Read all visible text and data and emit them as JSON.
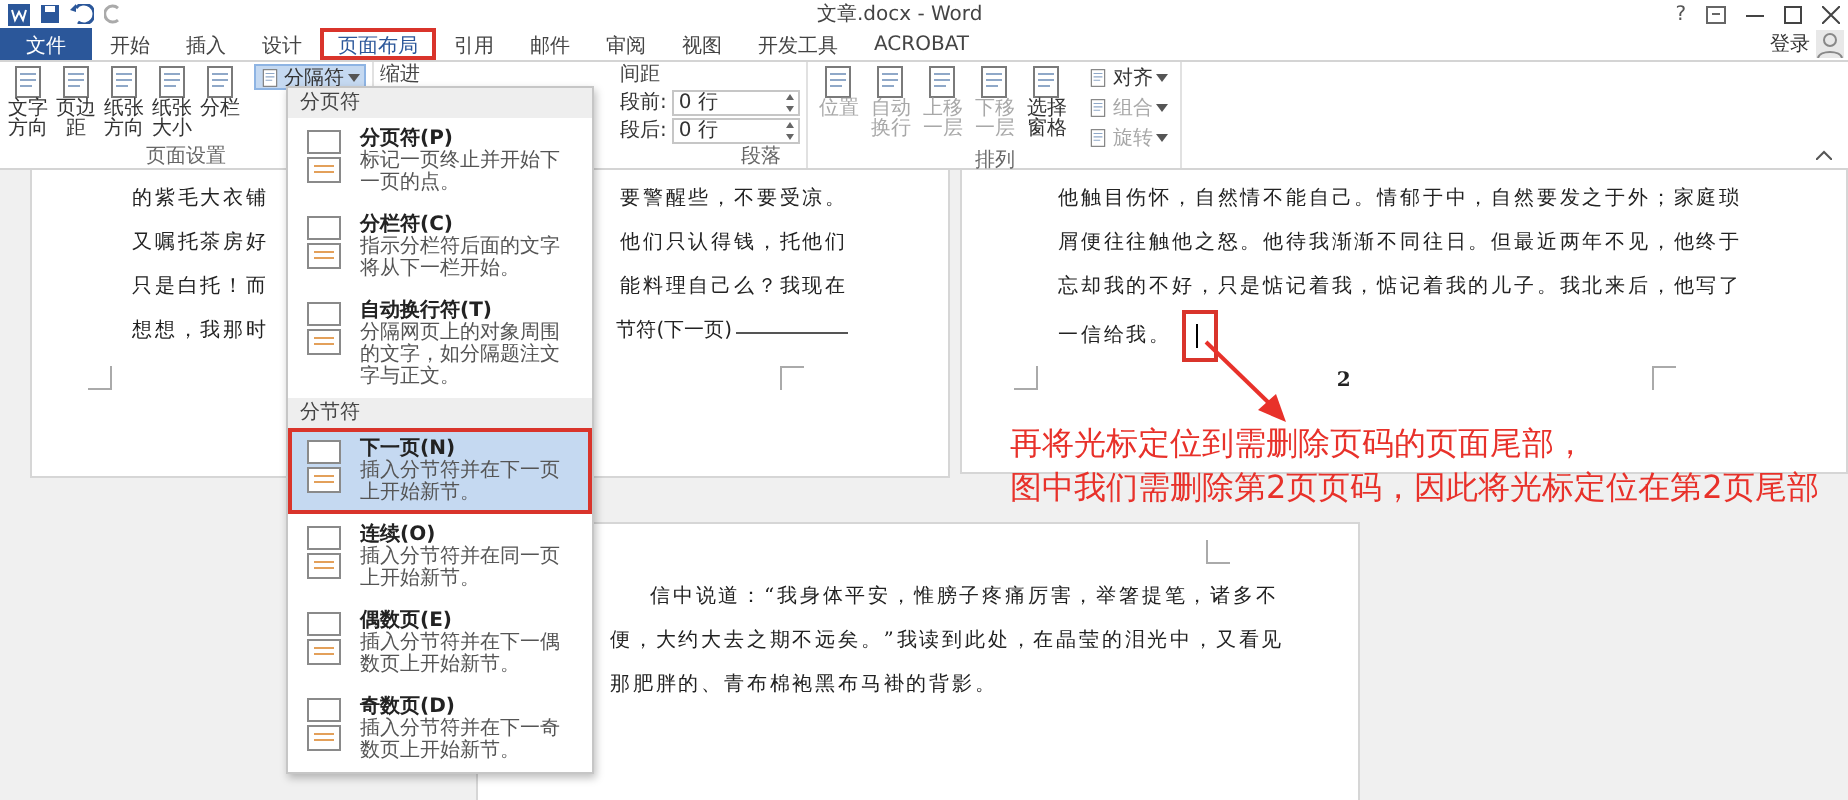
{
  "title_bar": {
    "title": "文章.docx - Word",
    "help": "?"
  },
  "tabs": [
    {
      "label": "文件",
      "kind": "file",
      "selected": false,
      "highlighted": false
    },
    {
      "label": "开始",
      "kind": "tab",
      "selected": false,
      "highlighted": false
    },
    {
      "label": "插入",
      "kind": "tab",
      "selected": false,
      "highlighted": false
    },
    {
      "label": "设计",
      "kind": "tab",
      "selected": false,
      "highlighted": false
    },
    {
      "label": "页面布局",
      "kind": "tab",
      "selected": true,
      "highlighted": true
    },
    {
      "label": "引用",
      "kind": "tab",
      "selected": false,
      "highlighted": false
    },
    {
      "label": "邮件",
      "kind": "tab",
      "selected": false,
      "highlighted": false
    },
    {
      "label": "审阅",
      "kind": "tab",
      "selected": false,
      "highlighted": false
    },
    {
      "label": "视图",
      "kind": "tab",
      "selected": false,
      "highlighted": false
    },
    {
      "label": "开发工具",
      "kind": "tab",
      "selected": false,
      "highlighted": false
    },
    {
      "label": "ACROBAT",
      "kind": "tab",
      "selected": false,
      "highlighted": false
    }
  ],
  "account": {
    "sign_in": "登录"
  },
  "ribbon": {
    "page_setup": {
      "label": "页面设置",
      "buttons": [
        {
          "label": "文字方向"
        },
        {
          "label": "页边距"
        },
        {
          "label": "纸张方向"
        },
        {
          "label": "纸张大小"
        },
        {
          "label": "分栏"
        }
      ],
      "breaks_button": {
        "label": "分隔符",
        "active": true
      }
    },
    "paragraph": {
      "label": "段落",
      "indent_label": "缩进",
      "spacing_label": "间距",
      "spacing_fields": [
        {
          "label": "段前:",
          "value": "0 行"
        },
        {
          "label": "段后:",
          "value": "0 行"
        }
      ]
    },
    "arrange": {
      "label": "排列",
      "large_buttons": [
        {
          "label": "位置",
          "disabled": true
        },
        {
          "label": "自动换行",
          "disabled": true
        },
        {
          "label": "上移一层",
          "disabled": true
        },
        {
          "label": "下移一层",
          "disabled": true
        },
        {
          "label": "选择窗格",
          "disabled": false
        }
      ],
      "small_buttons": [
        {
          "label": "对齐",
          "disabled": false
        },
        {
          "label": "组合",
          "disabled": true
        },
        {
          "label": "旋转",
          "disabled": true
        }
      ]
    }
  },
  "breaks_menu": {
    "sections": [
      {
        "header": "分页符",
        "items": [
          {
            "title": "分页符(P)",
            "description": "标记一页终止并开始下一页的点。",
            "selected": false,
            "highlighted": false
          },
          {
            "title": "分栏符(C)",
            "description": "指示分栏符后面的文字将从下一栏开始。",
            "selected": false,
            "highlighted": false
          },
          {
            "title": "自动换行符(T)",
            "description": "分隔网页上的对象周围的文字，如分隔题注文字与正文。",
            "selected": false,
            "highlighted": false
          }
        ]
      },
      {
        "header": "分节符",
        "items": [
          {
            "title": "下一页(N)",
            "description": "插入分节符并在下一页上开始新节。",
            "selected": true,
            "highlighted": true
          },
          {
            "title": "连续(O)",
            "description": "插入分节符并在同一页上开始新节。",
            "selected": false,
            "highlighted": false
          },
          {
            "title": "偶数页(E)",
            "description": "插入分节符并在下一偶数页上开始新节。",
            "selected": false,
            "highlighted": false
          },
          {
            "title": "奇数页(D)",
            "description": "插入分节符并在下一奇数页上开始新节。",
            "selected": false,
            "highlighted": false
          }
        ]
      }
    ]
  },
  "document": {
    "left_page": {
      "rows": [
        {
          "kind": "text",
          "left": "的紫毛大衣铺",
          "right": "要警醒些，不要受凉。"
        },
        {
          "kind": "text",
          "left": "又嘱托茶房好",
          "right": "他们只认得钱，托他们"
        },
        {
          "kind": "text",
          "left": "只是白托！而",
          "right": "能料理自己么？我现在"
        },
        {
          "kind": "section_break",
          "left": "想想，我那时",
          "right": "节符(下一页)"
        }
      ]
    },
    "right_page": {
      "lines": [
        "他触目伤怀，自然情不能自己。情郁于中，自然要发之于外；家庭琐",
        "屑便往往触他之怒。他待我渐渐不同往日。但最近两年不见，他终于",
        "忘却我的不好，只是惦记着我，惦记着我的儿子。我北来后，他写了",
        "一信给我。"
      ],
      "cursor": true,
      "page_number": "2"
    },
    "bottom_page": {
      "lines": [
        "信中说道：“我身体平安，惟膀子疼痛厉害，举箸提笔，诸多不",
        "便，大约大去之期不远矣。”我读到此处，在晶莹的泪光中，又看见",
        "那肥胖的、青布棉袍黑布马褂的背影。"
      ]
    }
  },
  "annotation": {
    "lines": [
      "再将光标定位到需删除页码的页面尾部，",
      "图中我们需删除第2页页码，因此将光标定位在第2页尾部"
    ]
  }
}
